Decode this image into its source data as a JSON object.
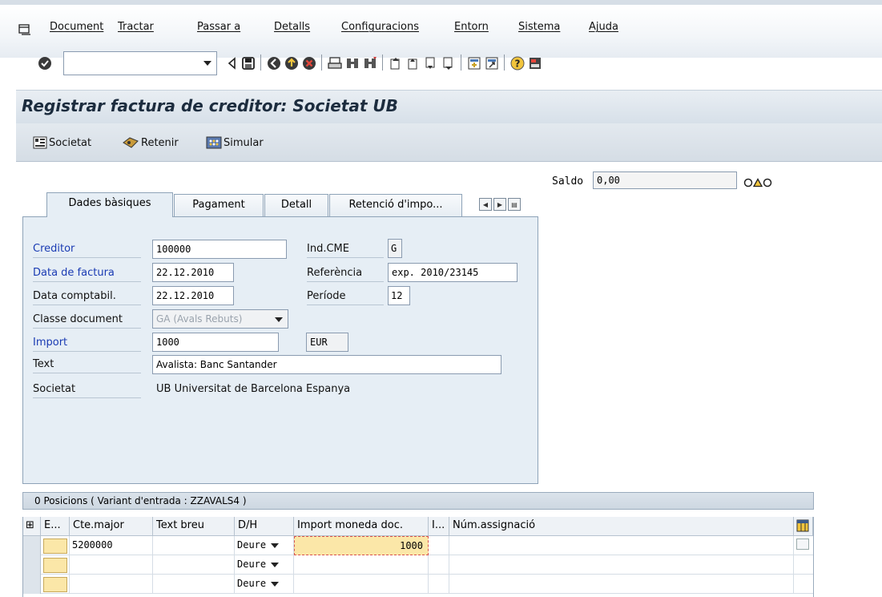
{
  "menu": {
    "items": [
      "Document",
      "Tractar",
      "Passar a",
      "Detalls",
      "Configuracions",
      "Entorn",
      "Sistema",
      "Ajuda"
    ]
  },
  "toolbar": {
    "command_value": "",
    "icons": [
      "enter-check-icon",
      "back-arrow-icon",
      "save-icon",
      "back-icon",
      "exit-icon",
      "cancel-icon",
      "print-icon",
      "find-icon",
      "find-next-icon",
      "first-page-icon",
      "previous-page-icon",
      "next-page-icon",
      "last-page-icon",
      "new-session-icon",
      "shortcut-icon",
      "help-icon",
      "layout-icon"
    ]
  },
  "title": "Registrar factura de creditor: Societat UB",
  "app_toolbar": {
    "societat": "Societat",
    "retenir": "Retenir",
    "simular": "Simular"
  },
  "saldo": {
    "label": "Saldo",
    "value": "0,00"
  },
  "tabs": [
    "Dades bàsiques",
    "Pagament",
    "Detall",
    "Retenció d'impo..."
  ],
  "form": {
    "creditor_label": "Creditor",
    "creditor_value": "100000",
    "data_factura_label": "Data de factura",
    "data_factura_value": "22.12.2010",
    "data_comptabil_label": "Data comptabil.",
    "data_comptabil_value": "22.12.2010",
    "classe_document_label": "Classe document",
    "classe_document_value": "GA (Avals Rebuts)",
    "import_label": "Import",
    "import_value": "1000",
    "currency": "EUR",
    "text_label": "Text",
    "text_value": "Avalista: Banc Santander",
    "societat_label": "Societat",
    "societat_value": "UB Universitat de Barcelona Espanya",
    "ind_cme_label": "Ind.CME",
    "ind_cme_value": "G",
    "referencia_label": "Referència",
    "referencia_value": "exp. 2010/23145",
    "periode_label": "Període",
    "periode_value": "12"
  },
  "positions": {
    "header": "0 Posicions ( Variant d'entrada : ZZAVALS4 )",
    "columns": [
      "E...",
      "Cte.major",
      "Text breu",
      "D/H",
      "Import moneda doc.",
      "I...",
      "Núm.assignació"
    ],
    "rows": [
      {
        "cte_major": "5200000",
        "text_breu": "",
        "dh": "Deure",
        "import": "1000",
        "num_assignacio": ""
      },
      {
        "cte_major": "",
        "text_breu": "",
        "dh": "Deure",
        "import": "",
        "num_assignacio": ""
      },
      {
        "cte_major": "",
        "text_breu": "",
        "dh": "Deure",
        "import": "",
        "num_assignacio": ""
      }
    ]
  }
}
